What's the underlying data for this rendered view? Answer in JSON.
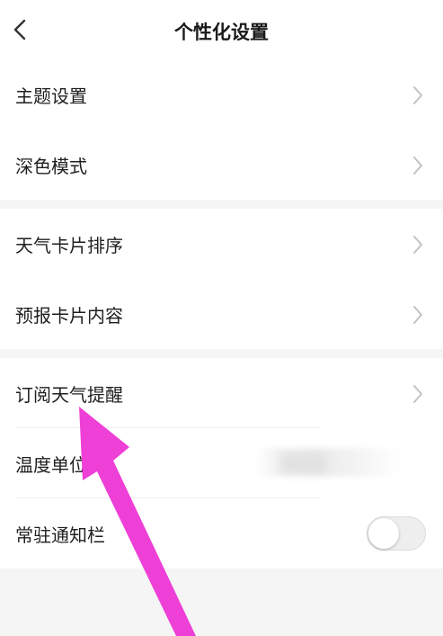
{
  "header": {
    "title": "个性化设置",
    "back_icon": "chevron-left-icon"
  },
  "groups": [
    {
      "items": [
        {
          "label": "主题设置",
          "accessory": "chevron-right-icon"
        },
        {
          "label": "深色模式",
          "accessory": "chevron-right-icon"
        }
      ]
    },
    {
      "items": [
        {
          "label": "天气卡片排序",
          "accessory": "chevron-right-icon"
        },
        {
          "label": "预报卡片内容",
          "accessory": "chevron-right-icon"
        }
      ]
    },
    {
      "items": [
        {
          "label": "订阅天气提醒",
          "accessory": "chevron-right-icon"
        },
        {
          "label": "温度单位",
          "value": "",
          "value_state": "blurred"
        },
        {
          "label": "常驻通知栏",
          "accessory": "toggle",
          "toggle_on": false
        }
      ]
    }
  ],
  "colors": {
    "background": "#f5f5f5",
    "row_background": "#ffffff",
    "annotation_arrow": "#ee3fd6"
  },
  "annotation": {
    "type": "arrow",
    "icon": "pink-arrow-icon"
  }
}
